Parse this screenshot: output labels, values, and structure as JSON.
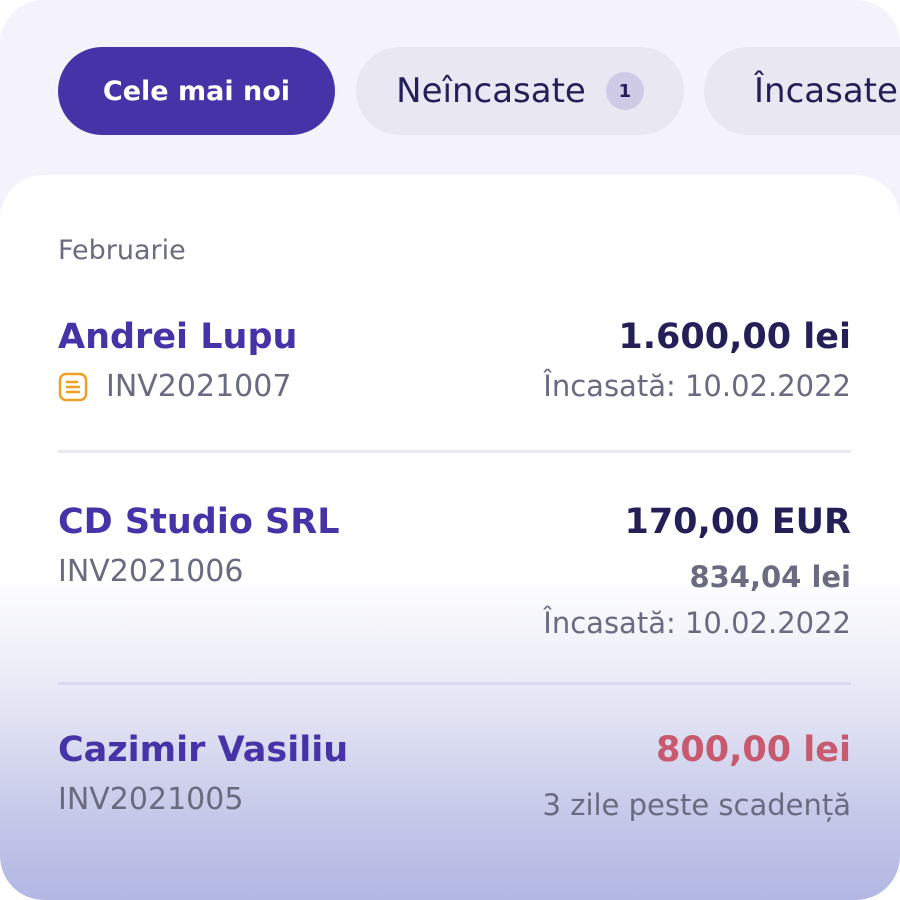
{
  "tabs": [
    {
      "label": "Cele mai noi",
      "active": true
    },
    {
      "label": "Neîncasate",
      "badge": "1",
      "active": false
    },
    {
      "label": "Încasate",
      "active": false
    }
  ],
  "section": {
    "title": "Februarie"
  },
  "invoices": [
    {
      "client": "Andrei Lupu",
      "number": "INV2021007",
      "icon": "document-icon",
      "amount": "1.600,00 lei",
      "status": "Încasată: 10.02.2022"
    },
    {
      "client": "CD Studio SRL",
      "number": "INV2021006",
      "amount": "170,00 EUR",
      "converted_amount": "834,04 lei",
      "status": "Încasată: 10.02.2022"
    },
    {
      "client": "Cazimir Vasiliu",
      "number": "INV2021005",
      "amount": "800,00 lei",
      "status": "3 zile peste scadență"
    }
  ],
  "colors": {
    "accent": "#4733a8",
    "tab_inactive": "#e9e7f2",
    "overdue": "#c85a6f",
    "icon": "#f0a021"
  }
}
